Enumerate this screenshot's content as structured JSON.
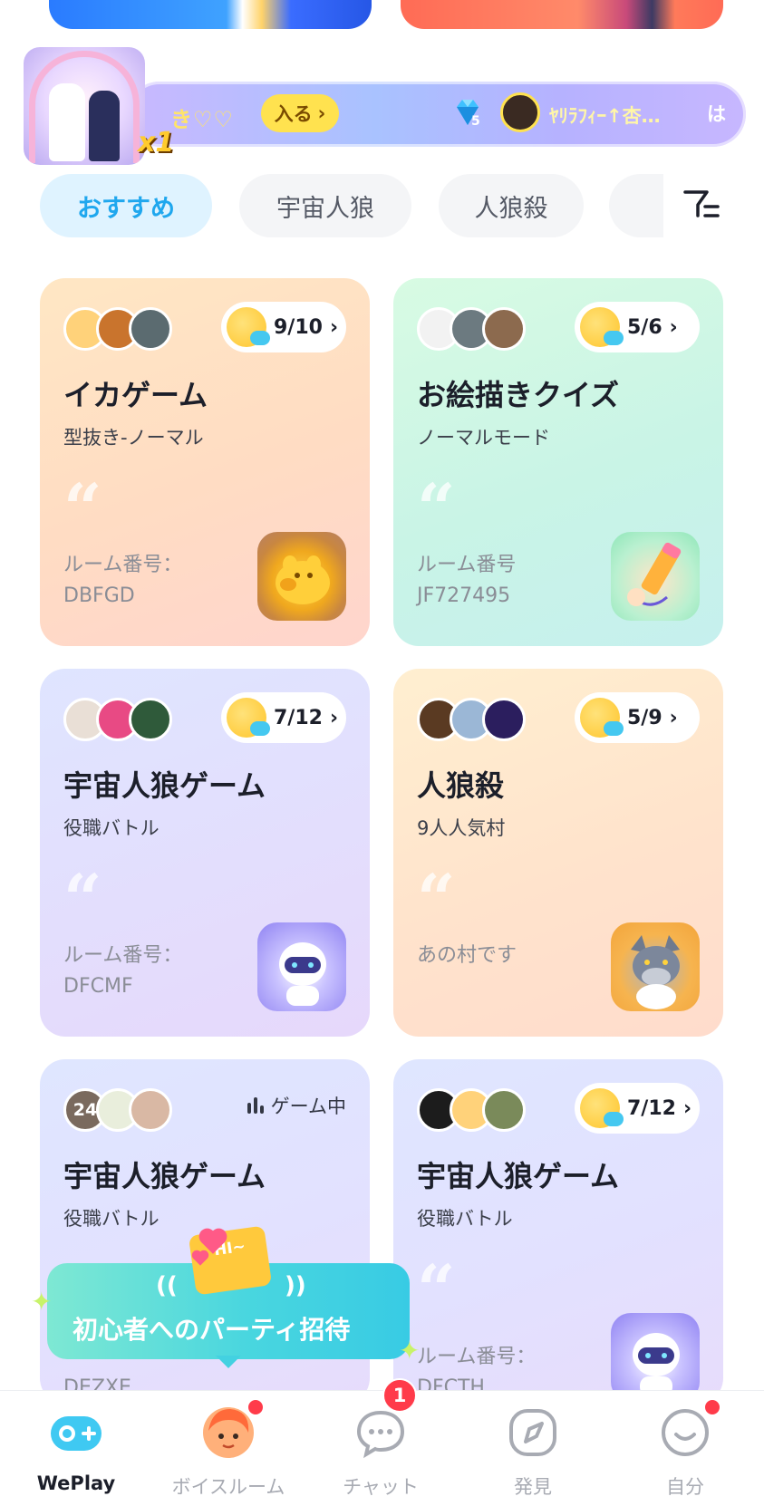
{
  "announcement": {
    "text": "き♡♡",
    "enter_label": "入る",
    "gem_count": "5",
    "username": "ﾔﾘﾗﾌｨｰ↑杏…",
    "trailing": "は",
    "gift_multiplier": "x1"
  },
  "tabs": [
    {
      "label": "おすすめ",
      "active": true
    },
    {
      "label": "宇宙人狼",
      "active": false
    },
    {
      "label": "人狼殺",
      "active": false
    }
  ],
  "cards": [
    {
      "count": "9/10",
      "title": "イカゲーム",
      "subtitle": "型抜き-ノーマル",
      "room_label": "ルーム番号：",
      "room_code": "DBFGD",
      "icon": "pig-game-icon"
    },
    {
      "count": "5/6",
      "title": "お絵描きクイズ",
      "subtitle": "ノーマルモード",
      "room_label": "ルーム番号",
      "room_code": "JF727495",
      "icon": "pencil-game-icon"
    },
    {
      "count": "7/12",
      "title": "宇宙人狼ゲーム",
      "subtitle": "役職バトル",
      "room_label": "ルーム番号：",
      "room_code": "DFCMF",
      "icon": "robot-game-icon"
    },
    {
      "count": "5/9",
      "title": "人狼殺",
      "subtitle": "9人人気村",
      "description": "あの村です",
      "icon": "wolf-game-icon"
    },
    {
      "status": "ゲーム中",
      "avatar_badge": "24",
      "title": "宇宙人狼ゲーム",
      "subtitle": "役職バトル",
      "room_code": "DEZXE"
    },
    {
      "count": "7/12",
      "title": "宇宙人狼ゲーム",
      "subtitle": "役職バトル",
      "room_label": "ルーム番号：",
      "room_code": "DFCTH",
      "icon": "robot-game-icon"
    }
  ],
  "invite": {
    "text": "初心者へのパーティ招待",
    "envelope_text": "HI~"
  },
  "nav": [
    {
      "label": "WePlay",
      "active": true
    },
    {
      "label": "ボイスルーム",
      "active": false
    },
    {
      "label": "チャット",
      "active": false,
      "badge": "1"
    },
    {
      "label": "発見",
      "active": false
    },
    {
      "label": "自分",
      "active": false
    }
  ],
  "colors": {
    "accent": "#1fa7ee",
    "badge": "#ff3b4a",
    "text_primary": "#1c1f2a",
    "text_muted": "#8a8d96"
  }
}
